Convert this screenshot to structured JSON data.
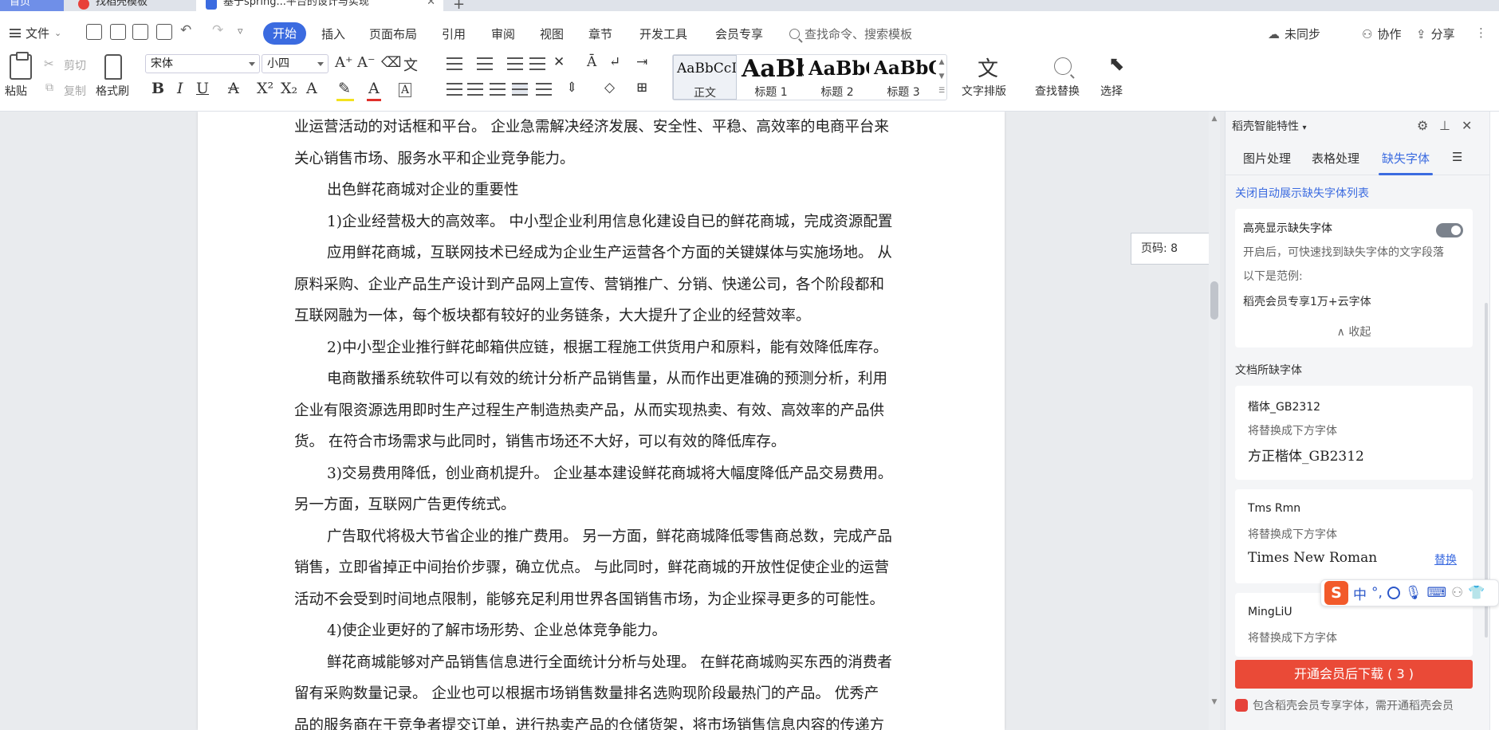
{
  "tabs": {
    "home": "首页",
    "template": "找稻壳模板",
    "doc": "基于spring...平台的设计与实现"
  },
  "menu": {
    "file": "文件",
    "start": "开始",
    "items": [
      "插入",
      "页面布局",
      "引用",
      "审阅",
      "视图",
      "章节",
      "开发工具",
      "会员专享"
    ],
    "search_placeholder": "查找命令、搜索模板",
    "unsynced": "未同步",
    "collab": "协作",
    "share": "分享"
  },
  "ribbon": {
    "paste": "粘贴",
    "cut": "剪切",
    "copy": "复制",
    "format_painter": "格式刷",
    "font_name": "宋体",
    "font_size": "小四",
    "styles": [
      {
        "sample": "AaBbCcDd",
        "name": "正文"
      },
      {
        "sample": "AaBb",
        "name": "标题 1"
      },
      {
        "sample": "AaBbC",
        "name": "标题 2"
      },
      {
        "sample": "AaBbC",
        "name": "标题 3"
      }
    ],
    "text_layout": "文字排版",
    "find_replace": "查找替换",
    "select": "选择"
  },
  "document": {
    "lines": [
      "业运营活动的对话框和平台。 企业急需解决经济发展、安全性、平稳、高效率的电商平台来",
      "关心销售市场、服务水平和企业竞争能力。",
      "出色鲜花商城对企业的重要性",
      "1)企业经营极大的高效率。 中小型企业利用信息化建设自已的鲜花商城，完成资源配置",
      "应用鲜花商城，互联网技术已经成为企业生产运营各个方面的关键媒体与实施场地。 从",
      "原料采购、企业产品生产设计到产品网上宣传、营销推广、分销、快递公司，各个阶段都和",
      "互联网融为一体，每个板块都有较好的业务链条，大大提升了企业的经营效率。",
      "2)中小型企业推行鲜花邮箱供应链，根据工程施工供货用户和原料，能有效降低库存。",
      "电商散播系统软件可以有效的统计分析产品销售量，从而作出更准确的预测分析，利用",
      "企业有限资源选用即时生产过程生产制造热卖产品，从而实现热卖、有效、高效率的产品供",
      "货。 在符合市场需求与此同时，销售市场还不大好，可以有效的降低库存。",
      "3)交易费用降低，创业商机提升。 企业基本建设鲜花商城将大幅度降低产品交易费用。",
      "另一方面，互联网广告更传统式。",
      "广告取代将极大节省企业的推广费用。 另一方面，鲜花商城降低零售商总数，完成产品",
      "销售，立即省掉正中间抬价步骤，确立优点。 与此同时，鲜花商城的开放性促使企业的运营",
      "活动不会受到时间地点限制，能够充足利用世界各国销售市场，为企业探寻更多的可能性。",
      "4)使企业更好的了解市场形势、企业总体竞争能力。",
      "鲜花商城能够对产品销售信息进行全面统计分析与处理。 在鲜花商城购买东西的消费者",
      "留有采购数量记录。 企业也可以根据市场销售数量排名选购现阶段最热门的产品。 优秀产",
      "品的服务商在于竞争者提交订单，进行热卖产品的仓储货架，将市场销售信息内容的传递方"
    ],
    "page_indicator": "页码: 8"
  },
  "panel": {
    "title": "稻壳智能特性",
    "tabs": [
      "图片处理",
      "表格处理",
      "缺失字体"
    ],
    "link": "关闭自动展示缺失字体列表",
    "highlight": {
      "title": "高亮显示缺失字体",
      "desc": "开启后，可快速找到缺失字体的文字段落",
      "example_label": "以下是范例:",
      "example": "稻壳会员专享1万+云字体",
      "collapse": "收起"
    },
    "missing_title": "文档所缺字体",
    "replace_hint": "将替换成下方字体",
    "fonts": [
      {
        "original": "楷体_GB2312",
        "replacement": "方正楷体_GB2312"
      },
      {
        "original": "Tms Rmn",
        "replacement": "Times New Roman",
        "action": "替换"
      },
      {
        "original": "MingLiU",
        "replacement": ""
      }
    ],
    "download_button": "开通会员后下载 ( 3 )",
    "vip_note": "包含稻壳会员专享字体，需开通稻壳会员"
  },
  "ime": {
    "zh": "中",
    "punct": "°,"
  },
  "colors": {
    "accent": "#3b6be0",
    "download": "#ea4a37",
    "tab_home": "#6f8fe8"
  }
}
